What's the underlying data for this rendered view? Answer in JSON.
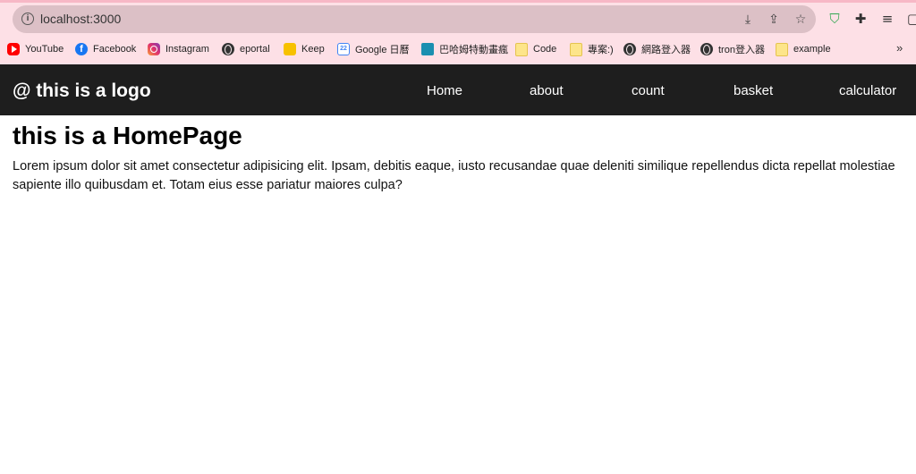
{
  "browser": {
    "url": "localhost:3000",
    "bookmarks": [
      {
        "label": "YouTube",
        "icon": "youtube-icon"
      },
      {
        "label": "Facebook",
        "icon": "facebook-icon"
      },
      {
        "label": "Instagram",
        "icon": "instagram-icon"
      },
      {
        "label": "eportal",
        "icon": "globe-icon"
      },
      {
        "label": "Keep",
        "icon": "keep-icon"
      },
      {
        "label": "Google 日曆",
        "icon": "google-calendar-icon"
      },
      {
        "label": "巴哈姆特動畫瘋",
        "icon": "bahamut-icon"
      },
      {
        "label": "Code",
        "icon": "folder-icon"
      },
      {
        "label": "專案:)",
        "icon": "folder-icon"
      },
      {
        "label": "網路登入器",
        "icon": "globe-icon"
      },
      {
        "label": "tron登入器",
        "icon": "globe-icon"
      },
      {
        "label": "example",
        "icon": "folder-icon"
      }
    ],
    "more_label": "»",
    "theme_color": "#fde0e6"
  },
  "navbar": {
    "logo": "@ this is a logo",
    "links": [
      "Home",
      "about",
      "count",
      "basket",
      "calculator"
    ],
    "background": "#1e1e1e"
  },
  "main": {
    "title": "this is a HomePage",
    "text": "Lorem ipsum dolor sit amet consectetur adipisicing elit. Ipsam, debitis eaque, iusto recusandae quae deleniti similique repellendus dicta repellat molestiae sapiente illo quibusdam et. Totam eius esse pariatur maiores culpa?"
  }
}
